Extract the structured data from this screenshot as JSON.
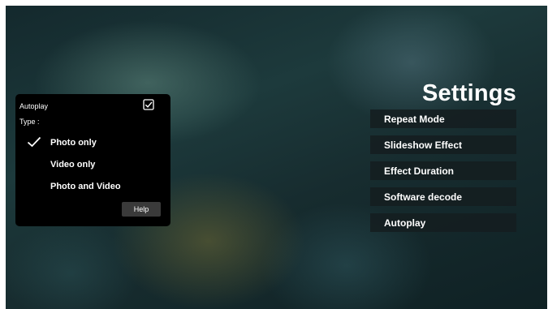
{
  "settings": {
    "title": "Settings",
    "menu": [
      {
        "label": "Repeat Mode"
      },
      {
        "label": "Slideshow Effect"
      },
      {
        "label": "Effect Duration"
      },
      {
        "label": "Software decode"
      },
      {
        "label": "Autoplay"
      }
    ]
  },
  "autoplay_panel": {
    "autoplay_label": "Autoplay",
    "autoplay_checked": true,
    "type_label": "Type :",
    "options": [
      {
        "label": "Photo only",
        "selected": true
      },
      {
        "label": "Video only",
        "selected": false
      },
      {
        "label": "Photo and Video",
        "selected": false
      }
    ],
    "help_label": "Help"
  },
  "icons": {
    "checkbox": "checkbox-checked-icon",
    "selected": "checkmark-icon"
  }
}
